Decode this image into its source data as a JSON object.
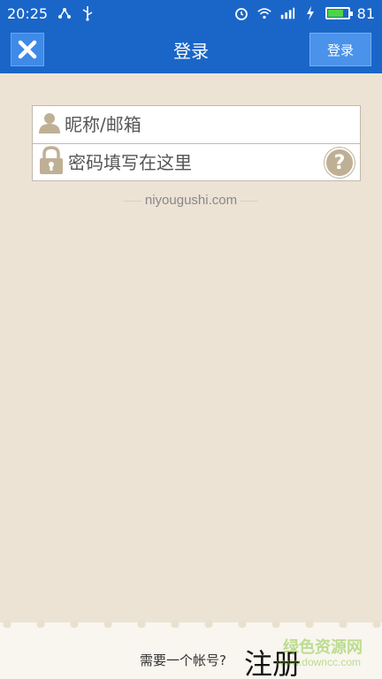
{
  "status_bar": {
    "time": "20:25",
    "battery": "81",
    "battery_color": "#4cd34a",
    "icons": [
      "share-icon",
      "usb-icon",
      "alarm-icon",
      "wifi-icon",
      "signal-icon",
      "charging-icon",
      "battery-icon"
    ]
  },
  "header": {
    "title": "登录",
    "close_icon": "close-icon",
    "login_label": "登录",
    "bar_color": "#1a66c8"
  },
  "form": {
    "username_placeholder": "昵称/邮箱",
    "password_placeholder": "密码填写在这里",
    "help_symbol": "?"
  },
  "site": "niyougushi.com",
  "footer": {
    "prompt": "需要一个帐号?",
    "register_label": "注册",
    "watermark": "绿色资源网",
    "watermark_sub": "www.downcc.com"
  }
}
